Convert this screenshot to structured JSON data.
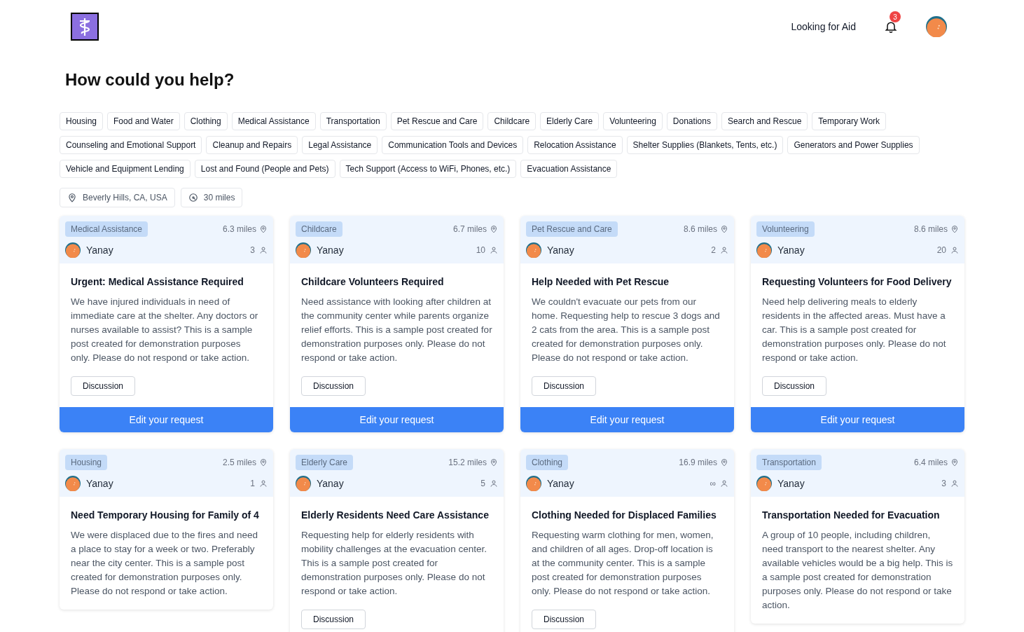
{
  "header": {
    "nav_link": "Looking for Aid",
    "notification_count": "3"
  },
  "title": "How could you help?",
  "categories": [
    "Housing",
    "Food and Water",
    "Clothing",
    "Medical Assistance",
    "Transportation",
    "Pet Rescue and Care",
    "Childcare",
    "Elderly Care",
    "Volunteering",
    "Donations",
    "Search and Rescue",
    "Temporary Work",
    "Counseling and Emotional Support",
    "Cleanup and Repairs",
    "Legal Assistance",
    "Communication Tools and Devices",
    "Relocation Assistance",
    "Shelter Supplies (Blankets, Tents, etc.)",
    "Generators and Power Supplies",
    "Vehicle and Equipment Lending",
    "Lost and Found (People and Pets)",
    "Tech Support (Access to WiFi, Phones, etc.)",
    "Evacuation Assistance"
  ],
  "filters": {
    "location": "Beverly Hills, CA, USA",
    "radius": "30 miles"
  },
  "columns": [
    [
      {
        "category": "Medical Assistance",
        "distance": "6.3 miles",
        "author": "Yanay",
        "count": "3",
        "title": "Urgent: Medical Assistance Required",
        "description": "We have injured individuals in need of immediate care at the shelter. Any doctors or nurses available to assist? This is a sample post created for demonstration purposes only. Please do not respond or take action.",
        "discussion": "Discussion",
        "edit": "Edit your request"
      },
      {
        "category": "Housing",
        "distance": "2.5 miles",
        "author": "Yanay",
        "count": "1",
        "title": "Need Temporary Housing for Family of 4",
        "description": "We were displaced due to the fires and need a place to stay for a week or two. Preferably near the city center. This is a sample post created for demonstration purposes only. Please do not respond or take action."
      }
    ],
    [
      {
        "category": "Childcare",
        "distance": "6.7 miles",
        "author": "Yanay",
        "count": "10",
        "title": "Childcare Volunteers Required",
        "description": "Need assistance with looking after children at the community center while parents organize relief efforts. This is a sample post created for demonstration purposes only. Please do not respond or take action.",
        "discussion": "Discussion",
        "edit": "Edit your request"
      },
      {
        "category": "Elderly Care",
        "distance": "15.2 miles",
        "author": "Yanay",
        "count": "5",
        "title": "Elderly Residents Need Care Assistance",
        "description": "Requesting help for elderly residents with mobility challenges at the evacuation center. This is a sample post created for demonstration purposes only. Please do not respond or take action.",
        "discussion": "Discussion"
      }
    ],
    [
      {
        "category": "Pet Rescue and Care",
        "distance": "8.6 miles",
        "author": "Yanay",
        "count": "2",
        "title": "Help Needed with Pet Rescue",
        "description": "We couldn't evacuate our pets from our home. Requesting help to rescue 3 dogs and 2 cats from the area. This is a sample post created for demonstration purposes only. Please do not respond or take action.",
        "discussion": "Discussion",
        "edit": "Edit your request"
      },
      {
        "category": "Clothing",
        "distance": "16.9 miles",
        "author": "Yanay",
        "count": "∞",
        "title": "Clothing Needed for Displaced Families",
        "description": "Requesting warm clothing for men, women, and children of all ages. Drop-off location is at the community center. This is a sample post created for demonstration purposes only. Please do not respond or take action.",
        "discussion": "Discussion"
      }
    ],
    [
      {
        "category": "Volunteering",
        "distance": "8.6 miles",
        "author": "Yanay",
        "count": "20",
        "title": "Requesting Volunteers for Food Delivery",
        "description": "Need help delivering meals to elderly residents in the affected areas. Must have a car. This is a sample post created for demonstration purposes only. Please do not respond or take action.",
        "discussion": "Discussion",
        "edit": "Edit your request"
      },
      {
        "category": "Transportation",
        "distance": "6.4 miles",
        "author": "Yanay",
        "count": "3",
        "title": "Transportation Needed for Evacuation",
        "description": "A group of 10 people, including children, need transport to the nearest shelter. Any available vehicles would be a big help. This is a sample post created for demonstration purposes only. Please do not respond or take action."
      }
    ]
  ]
}
